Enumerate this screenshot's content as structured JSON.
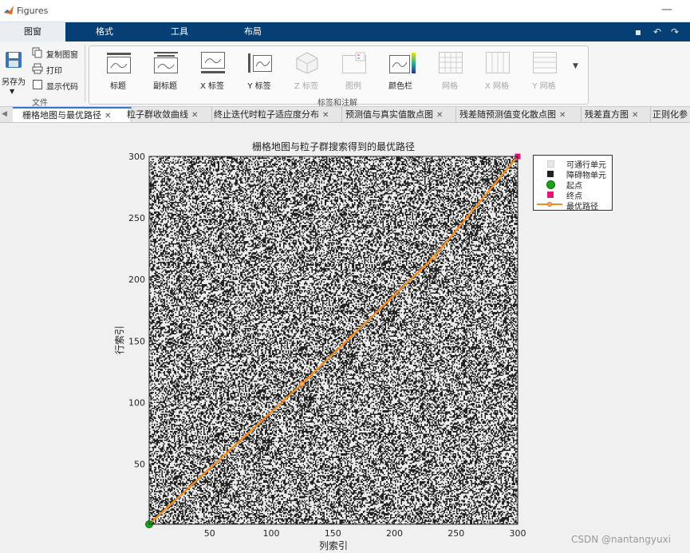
{
  "window": {
    "title": "Figures"
  },
  "ribbon_tabs": [
    "图窗",
    "格式",
    "工具",
    "布局"
  ],
  "file_group": {
    "saveas_label": "另存为",
    "copy_label": "复制图窗",
    "print_label": "打印",
    "showcode_label": "显示代码",
    "group_label": "文件"
  },
  "anno_group": {
    "group_label": "标签和注解",
    "tools": [
      "标题",
      "副标题",
      "X 标签",
      "Y 标签",
      "Z 标签",
      "图例",
      "颜色栏",
      "网格",
      "X 网格",
      "Y 网格"
    ]
  },
  "doc_tabs": [
    "栅格地图与最优路径",
    "粒子群收敛曲线",
    "终止迭代时粒子适应度分布",
    "预测值与真实值散点图",
    "残差随预测值变化散点图",
    "残差直方图",
    "正则化参"
  ],
  "colors": {
    "accent": "#053f73",
    "path": "#f28e1c",
    "start": "#1aa11a",
    "goal": "#e0157a"
  },
  "chart_data": {
    "type": "heatmap",
    "title": "栅格地图与粒子群搜索得到的最优路径",
    "xlabel": "列索引",
    "ylabel": "行索引",
    "xlim": [
      1,
      300
    ],
    "ylim": [
      1,
      300
    ],
    "xticks": [
      50,
      100,
      150,
      200,
      250,
      300
    ],
    "yticks": [
      50,
      100,
      150,
      200,
      250,
      300
    ],
    "grid_size": [
      300,
      300
    ],
    "obstacle_density": 0.45,
    "start": [
      1,
      1
    ],
    "goal": [
      300,
      300
    ],
    "path": [
      [
        1,
        1
      ],
      [
        125,
        115
      ],
      [
        232,
        218
      ],
      [
        300,
        300
      ]
    ],
    "legend": [
      "可通行单元",
      "障碍物单元",
      "起点",
      "终点",
      "最优路径"
    ],
    "legend_position": "outside-right-top"
  },
  "watermark": "CSDN @nantangyuxi"
}
